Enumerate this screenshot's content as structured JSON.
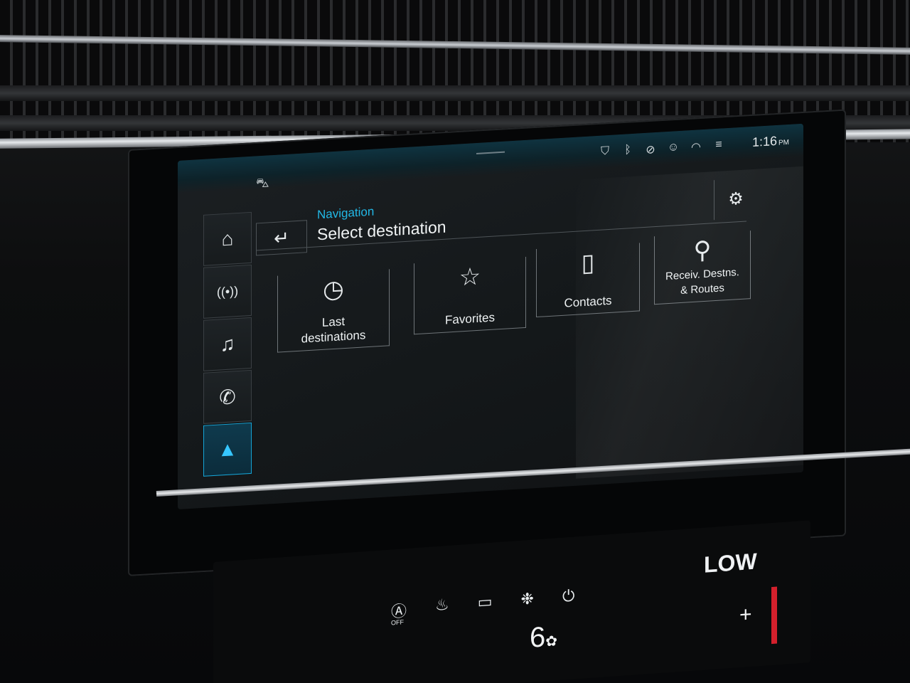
{
  "status": {
    "time": "1:16",
    "ampm": "PM",
    "icons": [
      "shield-location-icon",
      "bluetooth-icon",
      "mute-icon",
      "person-icon",
      "wifi-icon",
      "lte-icon"
    ]
  },
  "sidenav": {
    "items": [
      {
        "name": "home",
        "glyph": "⌂"
      },
      {
        "name": "radio",
        "glyph": "((•))"
      },
      {
        "name": "media",
        "glyph": "♫"
      },
      {
        "name": "phone",
        "glyph": "✆"
      },
      {
        "name": "navigation",
        "glyph": "▲"
      }
    ],
    "active": "navigation"
  },
  "header": {
    "section": "Navigation",
    "title": "Select destination",
    "back_glyph": "↵",
    "settings_glyph": "⚙"
  },
  "tiles": [
    {
      "id": "last",
      "line1": "Last",
      "line2": "destinations",
      "icon": "clock-icon",
      "glyph": "◷"
    },
    {
      "id": "favorites",
      "line1": "",
      "line2": "Favorites",
      "icon": "star-icon",
      "glyph": "☆"
    },
    {
      "id": "contacts",
      "line1": "",
      "line2": "Contacts",
      "icon": "contacts-book-icon",
      "glyph": "▯"
    },
    {
      "id": "received",
      "line1": "Receiv. Destns.",
      "line2": "& Routes",
      "icon": "location-pin-icon",
      "glyph": "⚲"
    }
  ],
  "climate": {
    "mode": "LOW",
    "fan_level": "6",
    "auto_label": "OFF",
    "plus": "+"
  },
  "colors": {
    "accent": "#22b8e6",
    "active_nav": "#36c6ff",
    "background": "#14181a"
  }
}
